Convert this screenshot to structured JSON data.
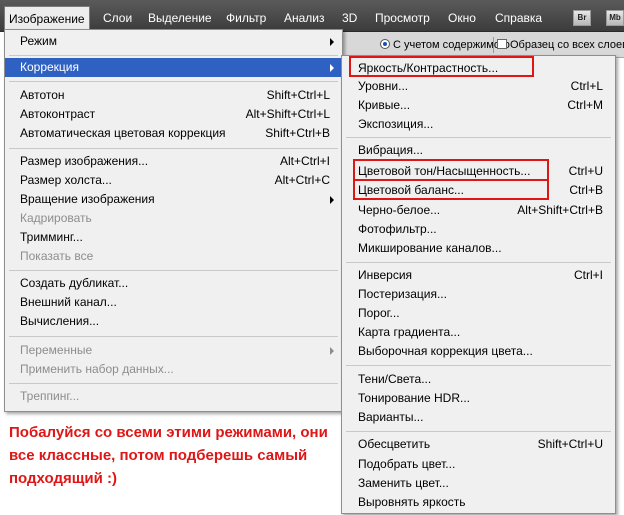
{
  "menubar": {
    "items": [
      "Изображение",
      "Слои",
      "Выделение",
      "Фильтр",
      "Анализ",
      "3D",
      "Просмотр",
      "Окно",
      "Справка"
    ],
    "bridge_button": "Br",
    "minibridge_button": "Mb"
  },
  "options_bar": {
    "content_aware_label": "С учетом содержимого",
    "sample_all_layers_label": "Образец со всех слоев"
  },
  "image_menu": {
    "items": [
      {
        "label": "Режим",
        "shortcut": "",
        "submenu": true,
        "disabled": false,
        "highlighted": false
      },
      {
        "label": "Коррекция",
        "shortcut": "",
        "submenu": true,
        "disabled": false,
        "highlighted": true
      },
      {
        "label": "Автотон",
        "shortcut": "Shift+Ctrl+L",
        "submenu": false,
        "disabled": false,
        "highlighted": false
      },
      {
        "label": "Автоконтраст",
        "shortcut": "Alt+Shift+Ctrl+L",
        "submenu": false,
        "disabled": false,
        "highlighted": false
      },
      {
        "label": "Автоматическая цветовая коррекция",
        "shortcut": "Shift+Ctrl+B",
        "submenu": false,
        "disabled": false,
        "highlighted": false
      },
      {
        "label": "Размер изображения...",
        "shortcut": "Alt+Ctrl+I",
        "submenu": false,
        "disabled": false,
        "highlighted": false
      },
      {
        "label": "Размер холста...",
        "shortcut": "Alt+Ctrl+C",
        "submenu": false,
        "disabled": false,
        "highlighted": false
      },
      {
        "label": "Вращение изображения",
        "shortcut": "",
        "submenu": true,
        "disabled": false,
        "highlighted": false
      },
      {
        "label": "Кадрировать",
        "shortcut": "",
        "submenu": false,
        "disabled": true,
        "highlighted": false
      },
      {
        "label": "Тримминг...",
        "shortcut": "",
        "submenu": false,
        "disabled": false,
        "highlighted": false
      },
      {
        "label": "Показать все",
        "shortcut": "",
        "submenu": false,
        "disabled": true,
        "highlighted": false
      },
      {
        "label": "Создать дубликат...",
        "shortcut": "",
        "submenu": false,
        "disabled": false,
        "highlighted": false
      },
      {
        "label": "Внешний канал...",
        "shortcut": "",
        "submenu": false,
        "disabled": false,
        "highlighted": false
      },
      {
        "label": "Вычисления...",
        "shortcut": "",
        "submenu": false,
        "disabled": false,
        "highlighted": false
      },
      {
        "label": "Переменные",
        "shortcut": "",
        "submenu": true,
        "disabled": true,
        "highlighted": false
      },
      {
        "label": "Применить набор данных...",
        "shortcut": "",
        "submenu": false,
        "disabled": true,
        "highlighted": false
      },
      {
        "label": "Треппинг...",
        "shortcut": "",
        "submenu": false,
        "disabled": true,
        "highlighted": false
      }
    ]
  },
  "correction_submenu": {
    "items": [
      {
        "label": "Яркость/Контрастность...",
        "shortcut": "",
        "marked": true
      },
      {
        "label": "Уровни...",
        "shortcut": "Ctrl+L",
        "marked": false
      },
      {
        "label": "Кривые...",
        "shortcut": "Ctrl+M",
        "marked": false
      },
      {
        "label": "Экспозиция...",
        "shortcut": "",
        "marked": false
      },
      {
        "label": "Вибрация...",
        "shortcut": "",
        "marked": false
      },
      {
        "label": "Цветовой тон/Насыщенность...",
        "shortcut": "Ctrl+U",
        "marked": true
      },
      {
        "label": "Цветовой баланс...",
        "shortcut": "Ctrl+B",
        "marked": true
      },
      {
        "label": "Черно-белое...",
        "shortcut": "Alt+Shift+Ctrl+B",
        "marked": false
      },
      {
        "label": "Фотофильтр...",
        "shortcut": "",
        "marked": false
      },
      {
        "label": "Микширование каналов...",
        "shortcut": "",
        "marked": false
      },
      {
        "label": "Инверсия",
        "shortcut": "Ctrl+I",
        "marked": false
      },
      {
        "label": "Постеризация...",
        "shortcut": "",
        "marked": false
      },
      {
        "label": "Порог...",
        "shortcut": "",
        "marked": false
      },
      {
        "label": "Карта градиента...",
        "shortcut": "",
        "marked": false
      },
      {
        "label": "Выборочная коррекция цвета...",
        "shortcut": "",
        "marked": false
      },
      {
        "label": "Тени/Света...",
        "shortcut": "",
        "marked": false
      },
      {
        "label": "Тонирование HDR...",
        "shortcut": "",
        "marked": false
      },
      {
        "label": "Варианты...",
        "shortcut": "",
        "marked": false
      },
      {
        "label": "Обесцветить",
        "shortcut": "Shift+Ctrl+U",
        "marked": false
      },
      {
        "label": "Подобрать цвет...",
        "shortcut": "",
        "marked": false
      },
      {
        "label": "Заменить цвет...",
        "shortcut": "",
        "marked": false
      },
      {
        "label": "Выровнять яркость",
        "shortcut": "",
        "marked": false
      }
    ]
  },
  "annotation": {
    "text": "Побалуйся со всеми этими режимами, они все классные, потом подберешь самый подходящий :)",
    "color": "#e01515"
  },
  "colors": {
    "menubar_bg": "#4a4a4a",
    "highlight": "#2f61c3",
    "marker_red": "#e01515"
  }
}
